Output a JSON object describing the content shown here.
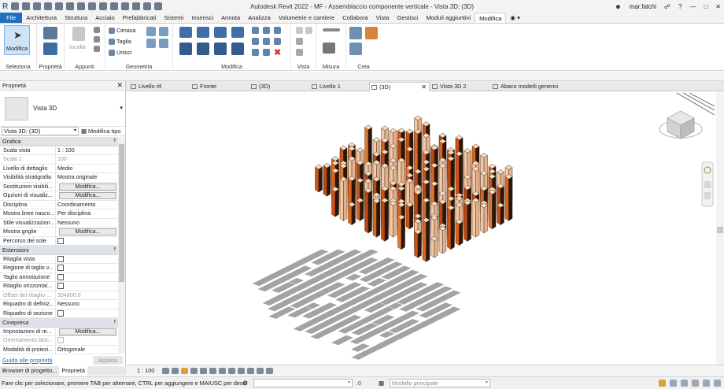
{
  "window": {
    "title": "Autodesk Revit 2022 - MF - Assemblaccio componente verticale - Vista 3D: (3D)",
    "user": "mar.falchi"
  },
  "ribbon_tabs": [
    "File",
    "Architettura",
    "Struttura",
    "Acciaio",
    "Prefabbricati",
    "Sistemi",
    "Inserisci",
    "Annota",
    "Analizza",
    "Volumetrie e cantiere",
    "Collabora",
    "Vista",
    "Gestisci",
    "Moduli aggiuntivi",
    "Modifica"
  ],
  "ribbon": {
    "modify_label": "Modifica",
    "paste_label": "Incolla",
    "cut_labels": [
      "Cimasa",
      "Taglia",
      "Unisci"
    ],
    "panels": [
      "Seleziona",
      "Proprietà",
      "Appunti",
      "Geometria",
      "Modifica",
      "Vista",
      "Misura",
      "Crea"
    ]
  },
  "properties": {
    "title": "Proprietà",
    "type_name": "Vista 3D",
    "view_selector": "Vista 3D: (3D)",
    "edit_type": "Modifica tipo",
    "sections": [
      {
        "name": "Grafica",
        "rows": [
          {
            "label": "Scala vista",
            "value": "1 : 100"
          },
          {
            "label": "Scala 1:",
            "value": "100",
            "dim": true
          },
          {
            "label": "Livello di dettaglio",
            "value": "Medio"
          },
          {
            "label": "Visibilità stratigrafia",
            "value": "Mostra originale"
          },
          {
            "label": "Sostituzioni visibili...",
            "value": "Modifica...",
            "button": true
          },
          {
            "label": "Opzioni di visualiz...",
            "value": "Modifica...",
            "button": true
          },
          {
            "label": "Disciplina",
            "value": "Coordinamento"
          },
          {
            "label": "Mostra linee nasco...",
            "value": "Per disciplina"
          },
          {
            "label": "Stile visualizzazion...",
            "value": "Nessuno"
          },
          {
            "label": "Mostra griglie",
            "value": "Modifica...",
            "button": true
          },
          {
            "label": "Percorso del sole",
            "value": "",
            "checkbox": true
          }
        ]
      },
      {
        "name": "Estensioni",
        "rows": [
          {
            "label": "Ritaglia vista",
            "value": "",
            "checkbox": true
          },
          {
            "label": "Regione di taglio v...",
            "value": "",
            "checkbox": true
          },
          {
            "label": "Taglio annotazione",
            "value": "",
            "checkbox": true
          },
          {
            "label": "Ritaglio orizzontal...",
            "value": "",
            "checkbox": true
          },
          {
            "label": "Offset del ritaglio ...",
            "value": "304800.0",
            "dim": true
          },
          {
            "label": "Riquadro di definiz...",
            "value": "Nessuno"
          },
          {
            "label": "Riquadro di sezione",
            "value": "",
            "checkbox": true
          }
        ]
      },
      {
        "name": "Cinepresa",
        "rows": [
          {
            "label": "Impostazioni di re...",
            "value": "Modifica...",
            "button": true
          },
          {
            "label": "Orientamento bloc...",
            "value": "",
            "checkbox": true,
            "dim": true
          },
          {
            "label": "Modalità di proiezi...",
            "value": "Ortogonale"
          }
        ]
      }
    ],
    "help_link": "Guida alle proprietà",
    "apply": "Applica"
  },
  "bottom_tabs": [
    "Browser di progetto...",
    "Proprietà"
  ],
  "view_tabs": [
    "Livello rif.",
    "Fronte",
    "(3D)",
    "Livello 1",
    "(3D)",
    "Vista 3D 2",
    "Abaco modelli generici"
  ],
  "view_control": {
    "scale": "1 : 100"
  },
  "status": {
    "text": "Fare clic per selezionare, premere TAB per alternare, CTRL per aggiungere e MAIUSC per desel",
    "coord": ":0",
    "model": "Modello principale"
  },
  "colors": {
    "file_tab": "#1e6fbf",
    "accent": "#1e6fbf",
    "orange": "#d7661e",
    "dark": "#2b1608",
    "shadow": "#9a9a9a"
  }
}
